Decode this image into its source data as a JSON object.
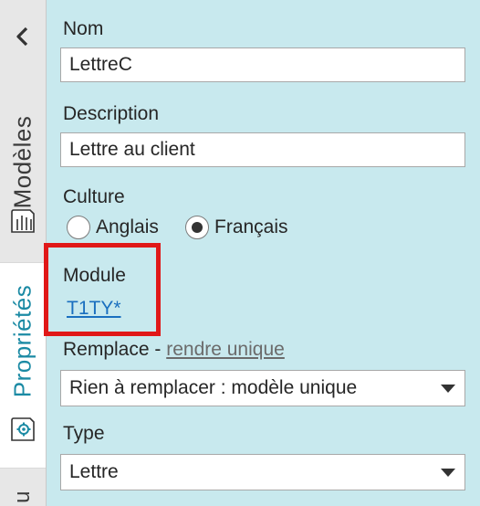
{
  "rail": {
    "tab_models": "Modèles",
    "tab_properties": "Propriétés",
    "tab_partial": "u"
  },
  "form": {
    "nom_label": "Nom",
    "nom_value": "LettreC",
    "description_label": "Description",
    "description_value": "Lettre au client",
    "culture_label": "Culture",
    "culture_options": [
      "Anglais",
      "Français"
    ],
    "culture_selected": "Français",
    "module_label": "Module",
    "module_value": "T1TY*",
    "remplace_label": "Remplace -",
    "rendre_unique_link": "rendre unique",
    "remplace_value": "Rien à remplacer : modèle unique",
    "type_label": "Type",
    "type_value": "Lettre"
  },
  "colors": {
    "panel_bg": "#c8e9ee",
    "accent": "#1b8aa4",
    "highlight": "#e01818",
    "link": "#1a6fbf"
  }
}
